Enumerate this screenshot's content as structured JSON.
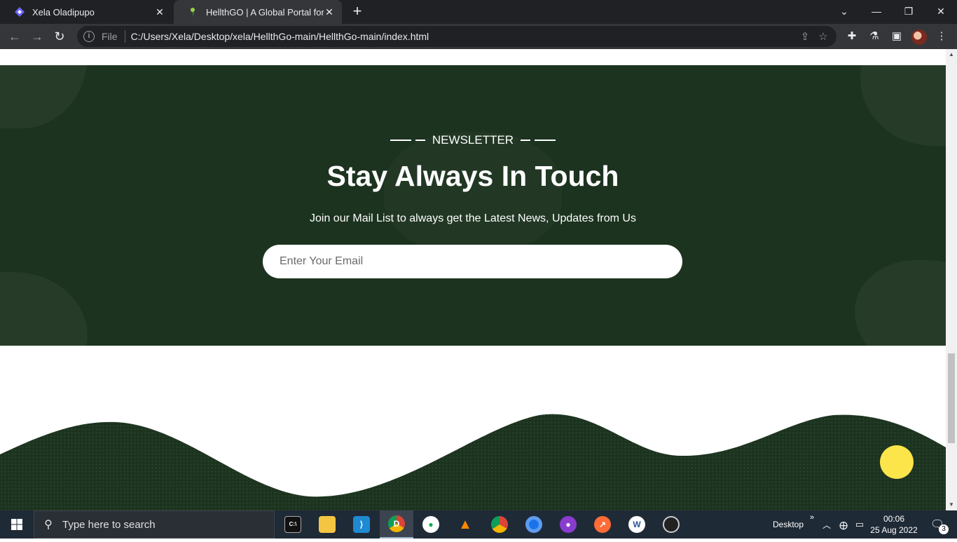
{
  "browser": {
    "tabs": [
      {
        "title": "Xela Oladipupo",
        "active": false
      },
      {
        "title": "HellthGO | A Global Portal for Ge",
        "active": true
      }
    ],
    "new_tab": "+",
    "omnibox": {
      "scheme_label": "File",
      "url": "C:/Users/Xela/Desktop/xela/HellthGo-main/HellthGo-main/index.html"
    }
  },
  "page": {
    "newsletter": {
      "eyebrow": "NEWSLETTER",
      "headline": "Stay Always In Touch",
      "subline": "Join our Mail List to always get the Latest News, Updates from Us",
      "email_placeholder": "Enter Your Email"
    },
    "colors": {
      "section_bg": "#1c331f",
      "accent_fab": "#fce54b"
    }
  },
  "taskbar": {
    "search_placeholder": "Type here to search",
    "apps": [
      "terminal-icon",
      "file-explorer-icon",
      "vscode-icon",
      "chrome-dev-icon",
      "mongodb-icon",
      "vlc-icon",
      "chrome-icon",
      "firefox-icon",
      "github-desktop-icon",
      "postman-icon",
      "word-icon",
      "obs-icon"
    ],
    "desktop_label": "Desktop",
    "time": "00:06",
    "date": "25 Aug 2022",
    "notifications": "3"
  }
}
